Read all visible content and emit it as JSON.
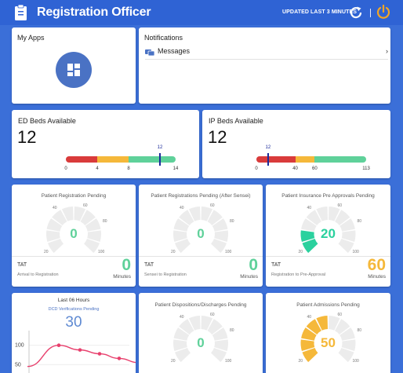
{
  "header": {
    "title": "Registration Officer",
    "updated": "UPDATED LAST 3 MINUTES",
    "accent": "#f5a623"
  },
  "my_apps": {
    "title": "My Apps"
  },
  "notifications": {
    "title": "Notifications",
    "items": [
      {
        "label": "Messages",
        "chevron": "›"
      }
    ]
  },
  "ed_beds": {
    "title": "ED Beds Available",
    "value": "12",
    "scale": {
      "min": 0,
      "max": 14,
      "ticks": [
        "0",
        "4",
        "8",
        "14"
      ],
      "tick_values": [
        0,
        4,
        8,
        14
      ],
      "marker": 12,
      "marker_label": "12",
      "segments": [
        {
          "from": 0,
          "to": 4,
          "color": "#d93b3b"
        },
        {
          "from": 4,
          "to": 8,
          "color": "#f5b83a"
        },
        {
          "from": 8,
          "to": 14,
          "color": "#5fd19a"
        }
      ]
    }
  },
  "ip_beds": {
    "title": "IP Beds Available",
    "value": "12",
    "scale": {
      "min": 0,
      "max": 113,
      "ticks": [
        "0",
        "40",
        "60",
        "113"
      ],
      "tick_values": [
        0,
        40,
        60,
        113
      ],
      "marker": 12,
      "marker_label": "12",
      "segments": [
        {
          "from": 0,
          "to": 40,
          "color": "#d93b3b"
        },
        {
          "from": 40,
          "to": 60,
          "color": "#f5b83a"
        },
        {
          "from": 60,
          "to": 113,
          "color": "#5fd19a"
        }
      ]
    }
  },
  "gauges": [
    {
      "title": "Patient Registration Pending",
      "value": "0",
      "fill": 0,
      "color": "#5fd19a",
      "ticks": [
        "40",
        "60",
        "80",
        "20",
        "100"
      ],
      "tat": {
        "label": "TAT",
        "sub": "Arrival to Registration",
        "value": "0",
        "unit": "Minutes",
        "color": "#5fd19a"
      }
    },
    {
      "title": "Patient Registrations Pending (After Sensei)",
      "value": "0",
      "fill": 0,
      "color": "#5fd19a",
      "ticks": [
        "40",
        "60",
        "80",
        "20",
        "100"
      ],
      "tat": {
        "label": "TAT",
        "sub": "Sensei to Registration",
        "value": "0",
        "unit": "Minutes",
        "color": "#5fd19a"
      }
    },
    {
      "title": "Patient Insurance Pre Approvals Pending",
      "value": "20",
      "fill": 20,
      "color": "#2bd19e",
      "ticks": [
        "40",
        "60",
        "80",
        "20",
        "100"
      ],
      "tat": {
        "label": "TAT",
        "sub": "Registration to Pre-Approval",
        "value": "60",
        "unit": "Minutes",
        "color": "#f5b83a"
      }
    },
    {
      "title": "Patient Dispositions/Discharges Pending",
      "value": "0",
      "fill": 0,
      "color": "#5fd19a",
      "ticks": [
        "40",
        "60",
        "80",
        "20",
        "100"
      ]
    },
    {
      "title": "Patient Admissions Pending",
      "value": "50",
      "fill": 50,
      "color": "#f5b83a",
      "ticks": [
        "40",
        "60",
        "80",
        "20",
        "100"
      ]
    }
  ],
  "dcd": {
    "heading": "Last 06 Hours",
    "subheading": "DCD Verifications Pending",
    "value": "30",
    "chart_data": {
      "type": "line",
      "x": [
        0,
        1,
        2,
        3,
        4,
        5
      ],
      "values": [
        45,
        100,
        88,
        78,
        66,
        55
      ],
      "yticks": [
        "100",
        "50"
      ],
      "ylim": [
        20,
        130
      ],
      "color": "#e8406d"
    }
  }
}
